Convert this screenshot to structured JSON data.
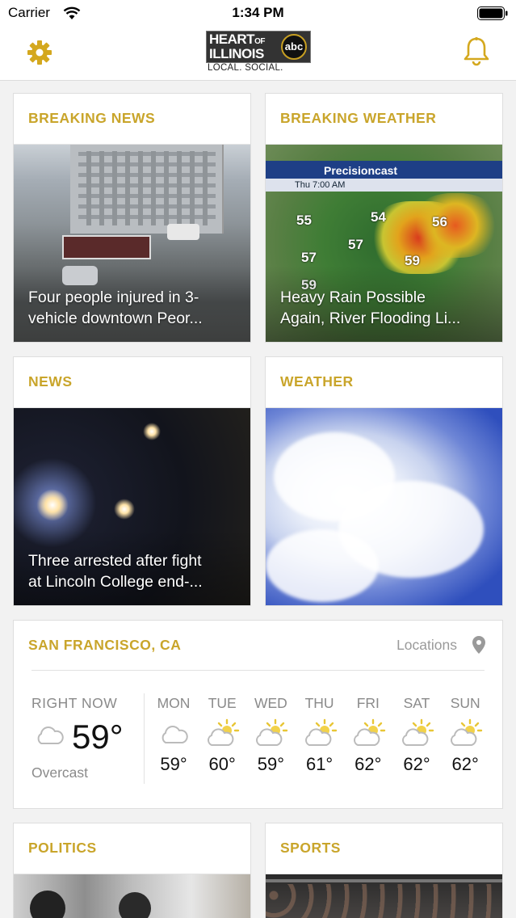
{
  "status_bar": {
    "carrier": "Carrier",
    "time": "1:34 PM"
  },
  "header": {
    "logo_line1": "HEART",
    "logo_of": "OF",
    "logo_line2": "ILLINOIS",
    "logo_badge": "abc",
    "tagline": "LOCAL. SOCIAL.",
    "settings_icon": "gear-icon",
    "notifications_icon": "bell-icon",
    "accent_color": "#c9a52b"
  },
  "cards": {
    "breaking_news": {
      "title": "BREAKING NEWS",
      "caption_line1": "Four people injured in 3-",
      "caption_line2": "vehicle downtown Peor..."
    },
    "breaking_weather": {
      "title": "BREAKING WEATHER",
      "caption_line1": "Heavy Rain Possible",
      "caption_line2": "Again, River Flooding Li...",
      "radar_title": "Precisioncast",
      "radar_time": "Thu 7:00 AM",
      "radar_values": [
        "55",
        "54",
        "56",
        "57",
        "57",
        "59",
        "59"
      ]
    },
    "news": {
      "title": "NEWS",
      "caption_line1": "Three arrested after fight",
      "caption_line2": "at Lincoln College end-..."
    },
    "weather": {
      "title": "WEATHER"
    },
    "politics": {
      "title": "POLITICS"
    },
    "sports": {
      "title": "SPORTS"
    }
  },
  "weather_widget": {
    "city": "SAN FRANCISCO, CA",
    "locations_label": "Locations",
    "right_now_label": "RIGHT NOW",
    "current_temp": "59°",
    "current_condition": "Overcast",
    "forecast": [
      {
        "day": "MON",
        "temp": "59°",
        "icon": "cloud-icon"
      },
      {
        "day": "TUE",
        "temp": "60°",
        "icon": "partly-sunny-icon"
      },
      {
        "day": "WED",
        "temp": "59°",
        "icon": "partly-sunny-icon"
      },
      {
        "day": "THU",
        "temp": "61°",
        "icon": "partly-sunny-icon"
      },
      {
        "day": "FRI",
        "temp": "62°",
        "icon": "partly-sunny-icon"
      },
      {
        "day": "SAT",
        "temp": "62°",
        "icon": "partly-sunny-icon"
      },
      {
        "day": "SUN",
        "temp": "62°",
        "icon": "partly-sunny-icon"
      }
    ]
  }
}
